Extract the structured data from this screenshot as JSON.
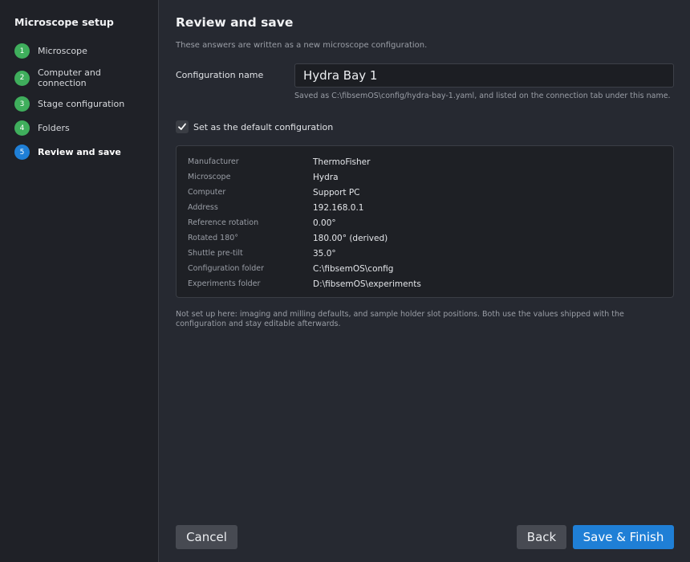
{
  "sidebar": {
    "title": "Microscope setup",
    "steps": [
      {
        "num": "1",
        "label": "Microscope"
      },
      {
        "num": "2",
        "label": "Computer and connection"
      },
      {
        "num": "3",
        "label": "Stage configuration"
      },
      {
        "num": "4",
        "label": "Folders"
      },
      {
        "num": "5",
        "label": "Review and save"
      }
    ],
    "active_step": 5
  },
  "main": {
    "title": "Review and save",
    "subtitle": "These answers are written as a new microscope configuration.",
    "config_name": {
      "label": "Configuration name",
      "value": "Hydra Bay 1",
      "hint": "Saved as C:\\fibsemOS\\config/hydra-bay-1.yaml, and listed on the connection tab under this name."
    },
    "default_checkbox": {
      "label": "Set as the default configuration",
      "checked": true
    },
    "summary": [
      {
        "key": "Manufacturer",
        "value": "ThermoFisher"
      },
      {
        "key": "Microscope",
        "value": "Hydra"
      },
      {
        "key": "Computer",
        "value": "Support PC"
      },
      {
        "key": "Address",
        "value": "192.168.0.1"
      },
      {
        "key": "Reference rotation",
        "value": "0.00°"
      },
      {
        "key": "Rotated 180°",
        "value": "180.00° (derived)"
      },
      {
        "key": "Shuttle pre-tilt",
        "value": "35.0°"
      },
      {
        "key": "Configuration folder",
        "value": "C:\\fibsemOS\\config"
      },
      {
        "key": "Experiments folder",
        "value": "D:\\fibsemOS\\experiments"
      }
    ],
    "note": "Not set up here: imaging and milling defaults, and sample holder slot positions. Both use the values shipped with the configuration and stay editable afterwards."
  },
  "buttons": {
    "cancel": "Cancel",
    "back": "Back",
    "save": "Save & Finish"
  },
  "colors": {
    "accent": "#1f7fd6",
    "step_complete": "#3fae5c"
  }
}
